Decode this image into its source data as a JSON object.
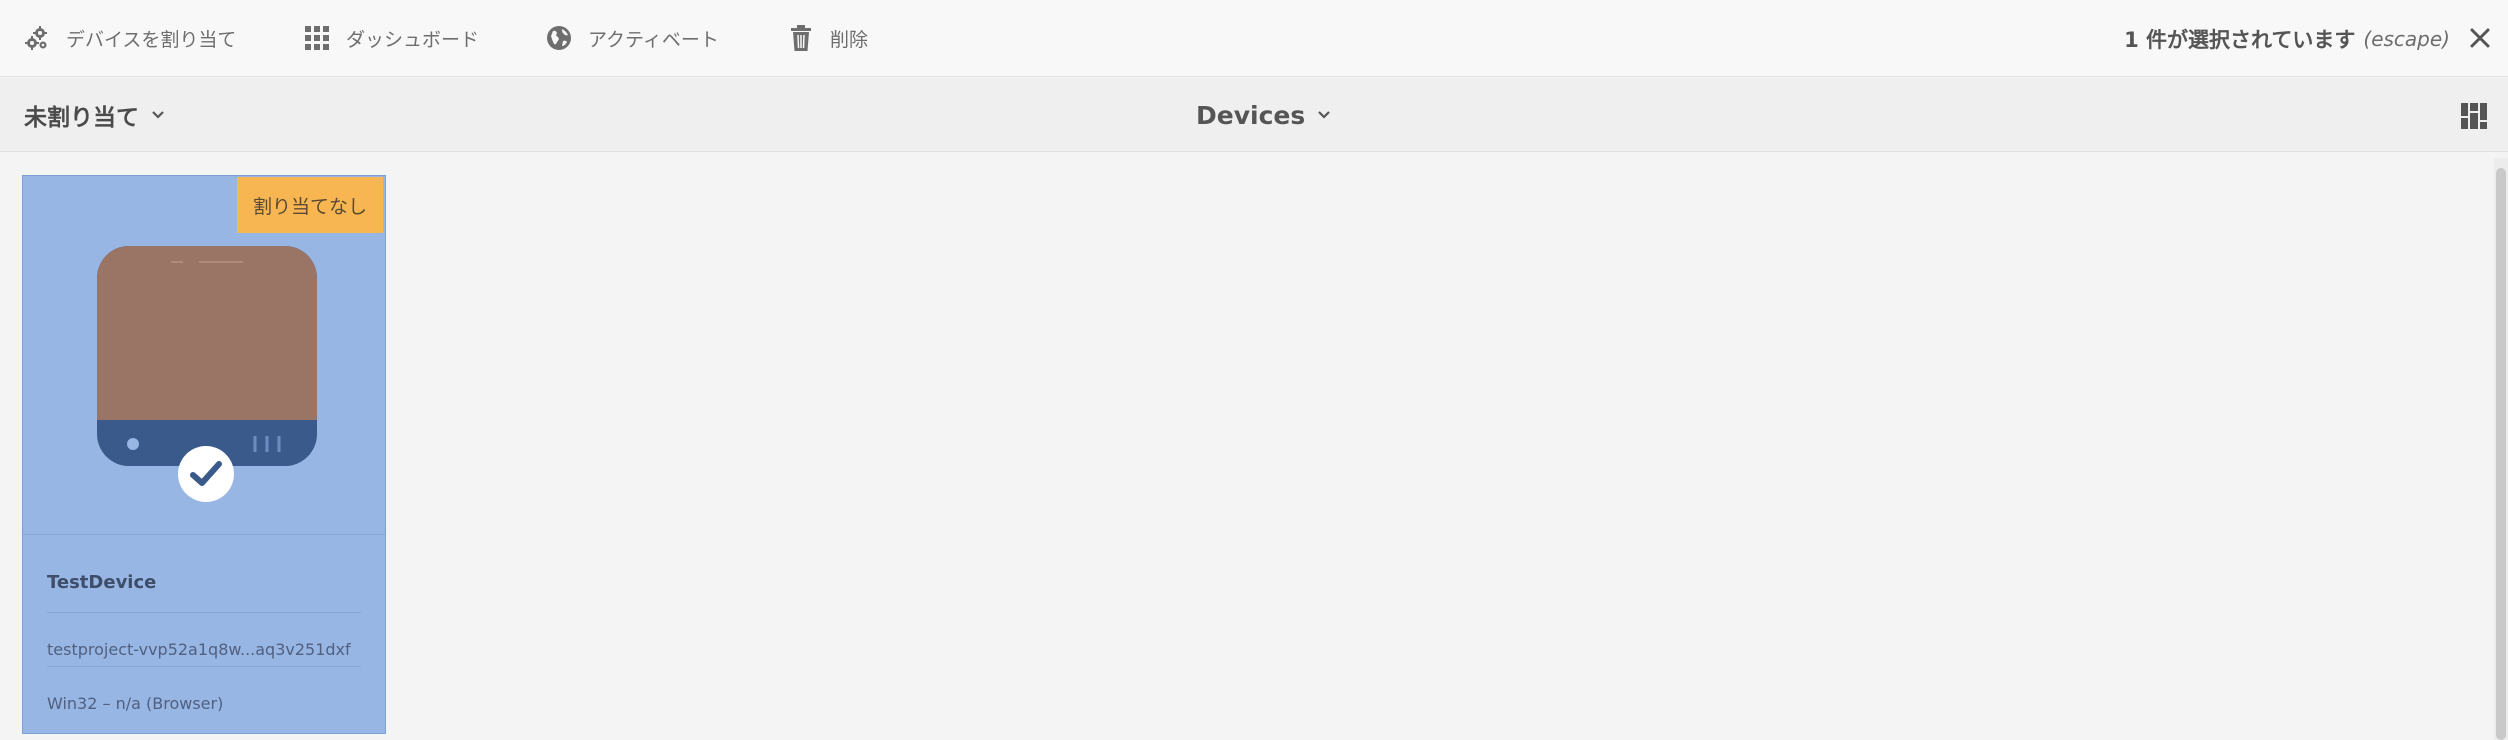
{
  "actionbar": {
    "actions": [
      {
        "label": "デバイスを割り当て",
        "icon": "gears-icon"
      },
      {
        "label": "ダッシュボード",
        "icon": "grid-icon"
      },
      {
        "label": "アクティベート",
        "icon": "globe-icon"
      },
      {
        "label": "削除",
        "icon": "trash-icon"
      }
    ],
    "selection_text": "1 件が選択されています",
    "escape_hint": "(escape)",
    "close_icon": "close-icon"
  },
  "titlebar": {
    "filter_label": "未割り当て",
    "title": "Devices",
    "view_icon": "view-switch-icon"
  },
  "card": {
    "badge": "割り当てなし",
    "name": "TestDevice",
    "id": "testproject-vvp52a1q8w...aq3v251dxf",
    "platform": "Win32 – n/a (Browser)",
    "colors": {
      "card_bg": "#98b6e4",
      "badge_bg": "#f7b652",
      "screen": "#9a7565",
      "base": "#3b5a8c"
    }
  }
}
